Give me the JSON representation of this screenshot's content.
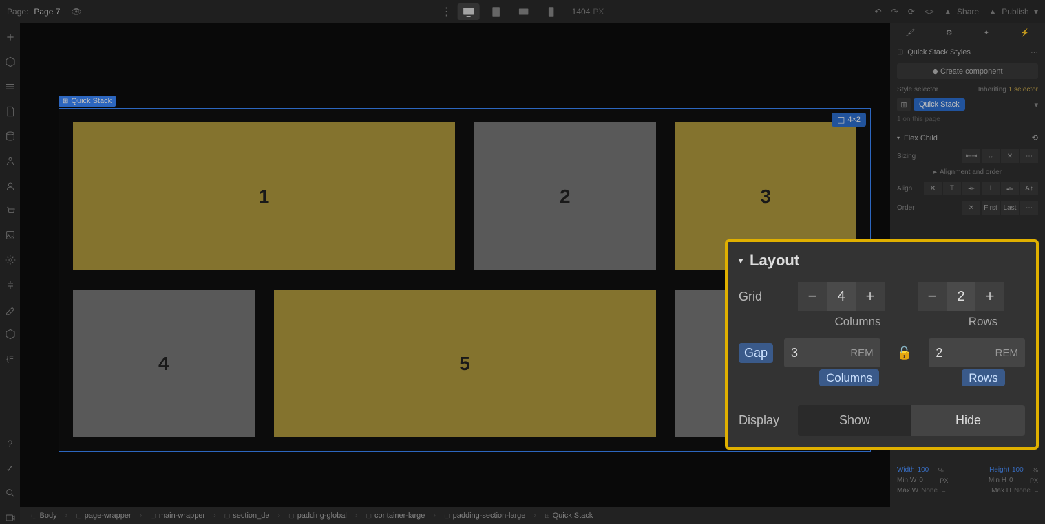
{
  "topbar": {
    "page_label": "Page:",
    "page_name": "Page 7",
    "canvas_width": "1404",
    "canvas_unit": "PX",
    "share": "Share",
    "publish": "Publish"
  },
  "canvas": {
    "quick_stack_label": "Quick Stack",
    "grid_badge": "4×2",
    "cells": [
      "1",
      "2",
      "3",
      "4",
      "5"
    ]
  },
  "right_panel": {
    "section_styles": "Quick Stack Styles",
    "create_component": "Create component",
    "style_selector": "Style selector",
    "inheriting": "Inheriting",
    "inheriting_count": "1 selector",
    "selector_pill": "Quick Stack",
    "on_page": "1 on this page",
    "flex_child": "Flex Child",
    "sizing": "Sizing",
    "alignment_order": "Alignment and order",
    "align": "Align",
    "order": "Order",
    "first": "First",
    "last": "Last",
    "size": {
      "width_label": "Width",
      "width_val": "100",
      "height_label": "Height",
      "height_val": "100",
      "minw_label": "Min W",
      "minw_val": "0",
      "minh_label": "Min H",
      "minh_val": "0",
      "maxw_label": "Max W",
      "maxw_val": "None",
      "maxh_label": "Max H",
      "maxh_val": "None",
      "pct": "%",
      "px": "PX",
      "dash": "–"
    }
  },
  "layout_callout": {
    "title": "Layout",
    "grid_label": "Grid",
    "columns_val": "4",
    "rows_val": "2",
    "columns_label": "Columns",
    "rows_label": "Rows",
    "gap_label": "Gap",
    "gap_col_val": "3",
    "gap_col_unit": "REM",
    "gap_row_val": "2",
    "gap_row_unit": "REM",
    "display_label": "Display",
    "show": "Show",
    "hide": "Hide"
  },
  "breadcrumb": [
    "Body",
    "page-wrapper",
    "main-wrapper",
    "section_de",
    "padding-global",
    "container-large",
    "padding-section-large",
    "Quick Stack"
  ]
}
